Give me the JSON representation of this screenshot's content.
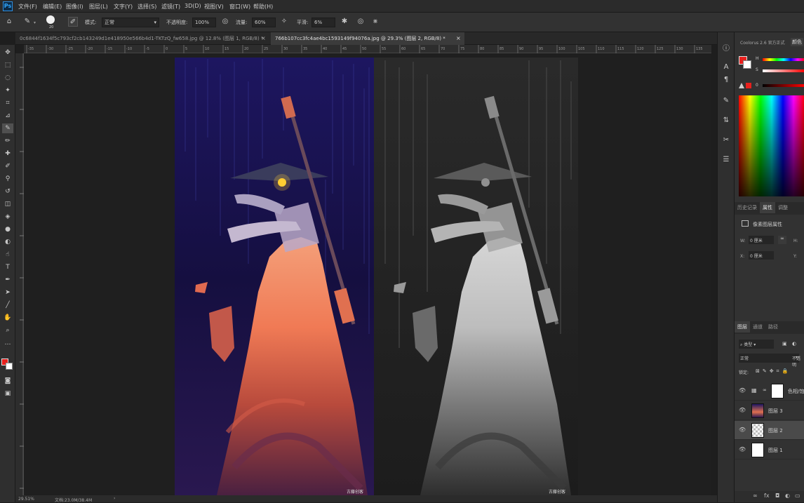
{
  "menubar": {
    "app_icon": "Ps",
    "items": [
      "文件(F)",
      "编辑(E)",
      "图像(I)",
      "图层(L)",
      "文字(Y)",
      "选择(S)",
      "滤镜(T)",
      "3D(D)",
      "视图(V)",
      "窗口(W)",
      "帮助(H)"
    ]
  },
  "options": {
    "brush_size": "20",
    "mode_label": "模式:",
    "mode_value": "正常",
    "opacity_label": "不透明度:",
    "opacity_value": "100%",
    "flow_label": "流量:",
    "flow_value": "60%",
    "smoothing_label": "平滑:",
    "smoothing_value": "6%"
  },
  "tabs": [
    {
      "label": "0c6844f1634f5c793cf2cb143249d1e418950e566b4d1-TKTzQ_fw658.jpg @ 12.8% (图层 1, RGB/8) *",
      "active": false
    },
    {
      "label": "766b107cc3fc4ae4bc1593149f94076a.jpg @ 29.3% (图层 2, RGB/8) *",
      "active": true
    }
  ],
  "ruler_numbers": [
    "-35",
    "-30",
    "-25",
    "-20",
    "-15",
    "-10",
    "-5",
    "0",
    "5",
    "10",
    "15",
    "20",
    "25",
    "30",
    "35",
    "40",
    "45",
    "50",
    "55",
    "60",
    "65",
    "70",
    "75",
    "80",
    "85",
    "90",
    "95",
    "100",
    "105",
    "110",
    "115",
    "120",
    "125",
    "130",
    "135"
  ],
  "canvas": {
    "watermark_left": "古藤创客",
    "watermark_right": "古藤创客"
  },
  "status": {
    "zoom": "29.51%",
    "doc": "文档:23.0M/38.4M"
  },
  "color_panel": {
    "title": "Coolorus 2.6 官方正式",
    "tab2": "颜色",
    "h_label": "H",
    "s_label": "S",
    "b_label": "B",
    "b_value": "0",
    "accent": "#e8201d"
  },
  "props_panel": {
    "tabs": [
      "历史记录",
      "属性",
      "调整"
    ],
    "active_tab": "属性",
    "kind": "像素图层属性",
    "w_label": "W:",
    "w_value": "0 厘米",
    "h_label": "H:",
    "x_label": "X:",
    "x_value": "0 厘米",
    "y_label": "Y:"
  },
  "layers_panel": {
    "tabs": [
      "图层",
      "通道",
      "路径"
    ],
    "active_tab": "图层",
    "filter": "类型",
    "blend": "正常",
    "opacity_label": "不透明",
    "lock_label": "锁定:",
    "layers": [
      {
        "name": "色相/饱…",
        "type": "adjustment",
        "selected": false
      },
      {
        "name": "图层 3",
        "type": "image",
        "selected": false
      },
      {
        "name": "图层 2",
        "type": "transparent",
        "selected": true
      },
      {
        "name": "图层 1",
        "type": "white",
        "selected": false
      }
    ]
  }
}
